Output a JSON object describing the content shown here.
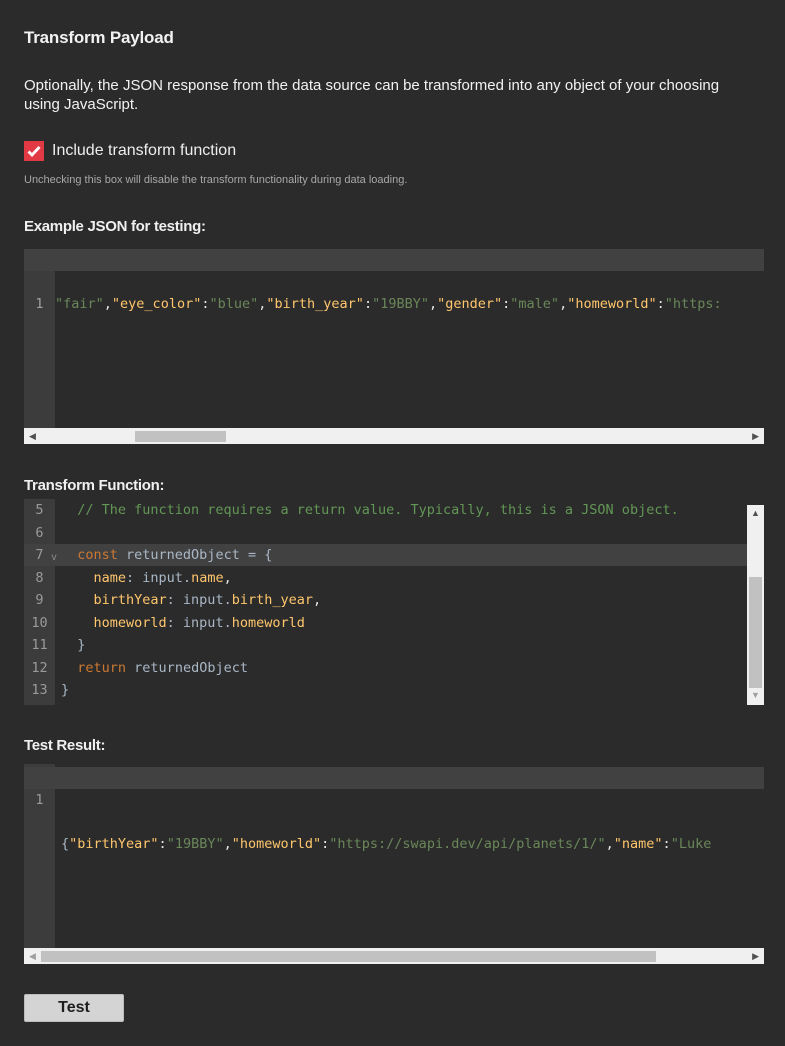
{
  "header": {
    "title": "Transform Payload"
  },
  "description": "Optionally, the JSON response from the data source can be transformed into any object of your choosing using JavaScript.",
  "include_transform": {
    "label": "Include transform function",
    "checked": true,
    "hint": "Unchecking this box will disable the transform functionality during data loading."
  },
  "example_json": {
    "label": "Example JSON for testing:",
    "line_number": "1",
    "tokens": [
      {
        "t": "\"fair\"",
        "c": "s"
      },
      {
        "t": ",",
        "c": "w"
      },
      {
        "t": "\"eye_color\"",
        "c": "p"
      },
      {
        "t": ":",
        "c": "w"
      },
      {
        "t": "\"blue\"",
        "c": "s"
      },
      {
        "t": ",",
        "c": "w"
      },
      {
        "t": "\"birth_year\"",
        "c": "p"
      },
      {
        "t": ":",
        "c": "w"
      },
      {
        "t": "\"19BBY\"",
        "c": "s"
      },
      {
        "t": ",",
        "c": "w"
      },
      {
        "t": "\"gender\"",
        "c": "p"
      },
      {
        "t": ":",
        "c": "w"
      },
      {
        "t": "\"male\"",
        "c": "s"
      },
      {
        "t": ",",
        "c": "w"
      },
      {
        "t": "\"homeworld\"",
        "c": "p"
      },
      {
        "t": ":",
        "c": "w"
      },
      {
        "t": "\"https:",
        "c": "s"
      }
    ]
  },
  "transform_function": {
    "label": "Transform Function:",
    "lines": [
      {
        "n": "5",
        "tokens": [
          {
            "t": "  // The function requires a return value. Typically, this is a JSON object.",
            "c": "c"
          }
        ]
      },
      {
        "n": "6",
        "tokens": []
      },
      {
        "n": "7",
        "fold": "v",
        "active": true,
        "tokens": [
          {
            "t": "  ",
            "c": "t"
          },
          {
            "t": "const",
            "c": "k"
          },
          {
            "t": " returnedObject = {",
            "c": "t"
          }
        ]
      },
      {
        "n": "8",
        "tokens": [
          {
            "t": "    ",
            "c": "t"
          },
          {
            "t": "name",
            "c": "p"
          },
          {
            "t": ": input.",
            "c": "t"
          },
          {
            "t": "name",
            "c": "p"
          },
          {
            "t": ",",
            "c": "w"
          }
        ]
      },
      {
        "n": "9",
        "tokens": [
          {
            "t": "    ",
            "c": "t"
          },
          {
            "t": "birthYear",
            "c": "p"
          },
          {
            "t": ": input.",
            "c": "t"
          },
          {
            "t": "birth_year",
            "c": "p"
          },
          {
            "t": ",",
            "c": "w"
          }
        ]
      },
      {
        "n": "10",
        "tokens": [
          {
            "t": "    ",
            "c": "t"
          },
          {
            "t": "homeworld",
            "c": "p"
          },
          {
            "t": ": input.",
            "c": "t"
          },
          {
            "t": "homeworld",
            "c": "p"
          }
        ]
      },
      {
        "n": "11",
        "tokens": [
          {
            "t": "  }",
            "c": "t"
          }
        ]
      },
      {
        "n": "12",
        "tokens": [
          {
            "t": "  ",
            "c": "t"
          },
          {
            "t": "return",
            "c": "k"
          },
          {
            "t": " returnedObject",
            "c": "t"
          }
        ]
      },
      {
        "n": "13",
        "tokens": [
          {
            "t": "}",
            "c": "t"
          }
        ]
      }
    ]
  },
  "test_result": {
    "label": "Test Result:",
    "line_number": "1",
    "tokens": [
      {
        "t": "{",
        "c": "t"
      },
      {
        "t": "\"birthYear\"",
        "c": "p"
      },
      {
        "t": ":",
        "c": "w"
      },
      {
        "t": "\"19BBY\"",
        "c": "s"
      },
      {
        "t": ",",
        "c": "w"
      },
      {
        "t": "\"homeworld\"",
        "c": "p"
      },
      {
        "t": ":",
        "c": "w"
      },
      {
        "t": "\"https://swapi.dev/api/planets/1/\"",
        "c": "s"
      },
      {
        "t": ",",
        "c": "w"
      },
      {
        "t": "\"name\"",
        "c": "p"
      },
      {
        "t": ":",
        "c": "w"
      },
      {
        "t": "\"Luke",
        "c": "s"
      }
    ]
  },
  "test_button": {
    "label": "Test"
  }
}
